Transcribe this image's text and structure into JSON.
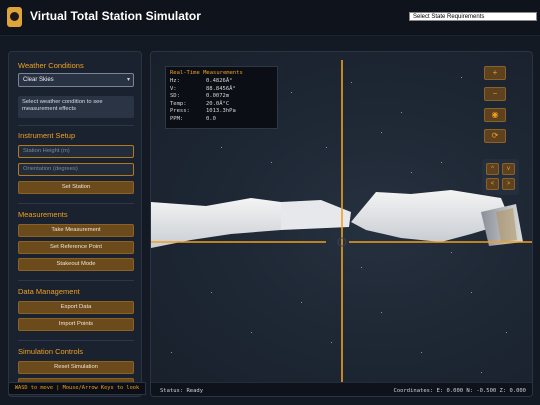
{
  "app": {
    "title": "Virtual Total Station Simulator",
    "state_select": "Select State Requirements"
  },
  "sidebar": {
    "weather": {
      "title": "Weather Conditions",
      "selected": "Clear Skies",
      "info": "Select weather condition to see measurement effects"
    },
    "instrument": {
      "title": "Instrument Setup",
      "height_placeholder": "Station Height (m)",
      "orientation_placeholder": "Orientation (degrees)",
      "set_station": "Set Station"
    },
    "measurements": {
      "title": "Measurements",
      "take": "Take Measurement",
      "reference": "Set Reference Point",
      "stakeout": "Stakeout Mode"
    },
    "data_management": {
      "title": "Data Management",
      "export": "Export Data",
      "import": "Import Points"
    },
    "simulation": {
      "title": "Simulation Controls",
      "reset": "Reset Simulation"
    }
  },
  "readout": {
    "title": "Real-Time Measurements",
    "rows": [
      {
        "key": "Hz:",
        "value": "0.4826Â°"
      },
      {
        "key": "V:",
        "value": "88.8456Â°"
      },
      {
        "key": "SD:",
        "value": "0.0072m"
      },
      {
        "key": "Temp:",
        "value": "20.0Â°C"
      },
      {
        "key": "Press:",
        "value": "1013.3hPa"
      },
      {
        "key": "PPM:",
        "value": "0.0"
      }
    ]
  },
  "controls": {
    "zoom_in": "+",
    "zoom_out": "−",
    "target": "◉",
    "reset": "⟳",
    "up": "^",
    "down": "v",
    "left": "<",
    "right": ">"
  },
  "status": {
    "text": "Status: Ready",
    "coords": "Coordinates: E: 0.000 N: -0.500 Z: 0.000"
  },
  "hint": "WASD to move | Mouse/Arrow Keys to look",
  "colors": {
    "accent": "#f0a020",
    "button_bg": "#6b4a1c",
    "panel_bg": "#1a2230"
  }
}
